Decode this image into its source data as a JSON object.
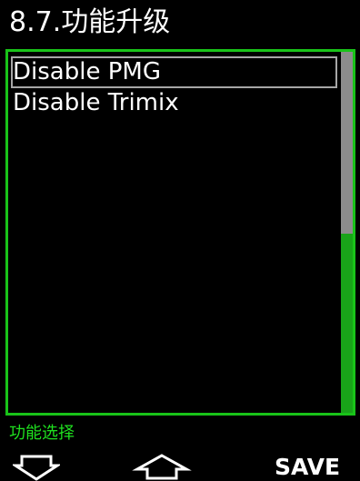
{
  "header": {
    "title": "8.7.功能升级"
  },
  "menu": {
    "items": [
      {
        "label": "Disable PMG",
        "selected": true
      },
      {
        "label": "Disable Trimix",
        "selected": false
      }
    ]
  },
  "scrollbar": {
    "thumb_color": "#8c8c8c",
    "track_color": "#19a319"
  },
  "status": {
    "text": "功能选择"
  },
  "softkeys": {
    "left_icon": "arrow-down-icon",
    "middle_icon": "arrow-up-icon",
    "right_label": "SAVE"
  },
  "colors": {
    "accent": "#19c319",
    "status_text": "#1fe01f",
    "selection_border": "#a6a6a6",
    "background": "#000000",
    "text": "#ffffff"
  }
}
